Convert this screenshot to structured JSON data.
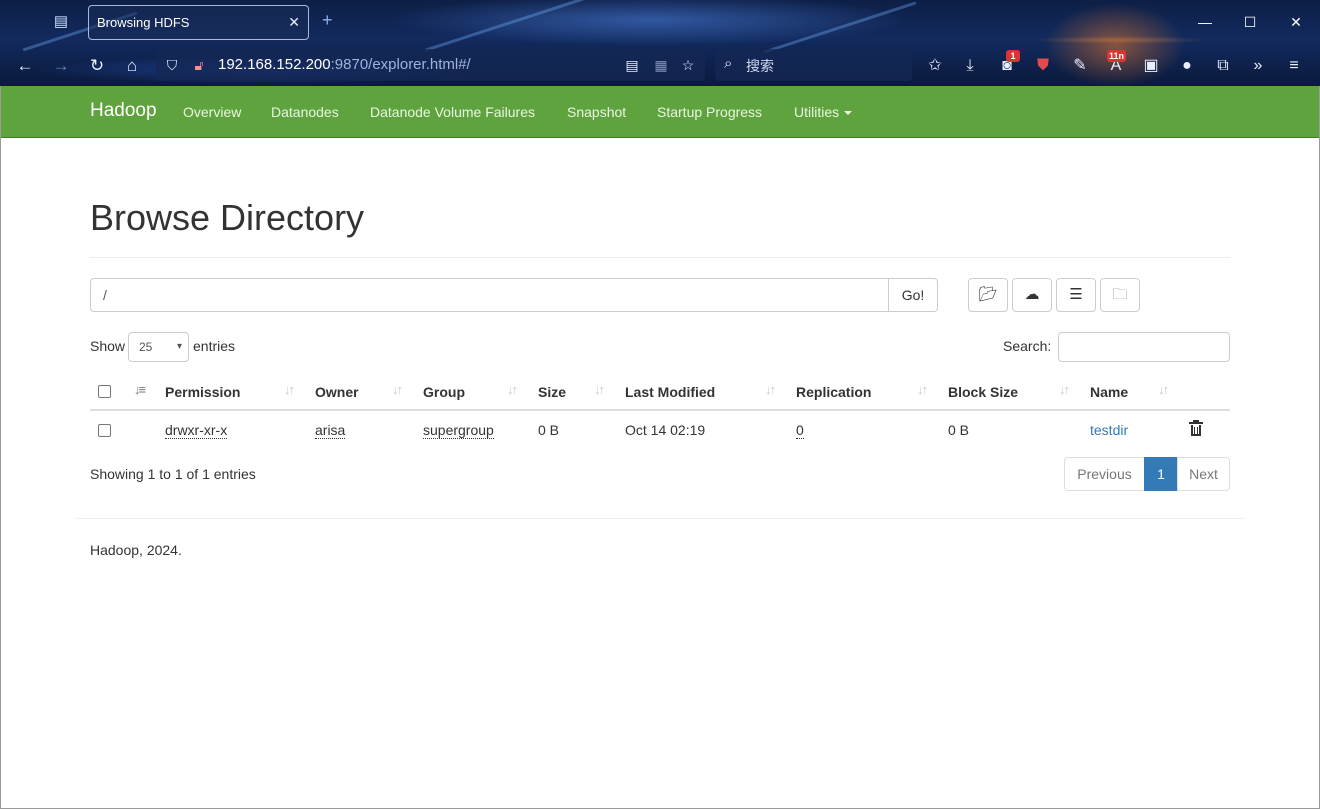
{
  "browser": {
    "tab_title": "Browsing HDFS",
    "tab_close": "✕",
    "new_tab": "+",
    "url_host": "192.168.152.200",
    "url_rest": ":9870/explorer.html#/",
    "search_placeholder": "搜索",
    "badges": {
      "tool3": "1",
      "tool6": "11n"
    },
    "window_buttons": {
      "minimize": "—",
      "maximize": "☐",
      "close": "✕"
    }
  },
  "navbar": {
    "brand": "Hadoop",
    "links": [
      "Overview",
      "Datanodes",
      "Datanode Volume Failures",
      "Snapshot",
      "Startup Progress",
      "Utilities"
    ]
  },
  "page": {
    "title": "Browse Directory",
    "path_value": "/",
    "go_label": "Go!",
    "show_label": "Show",
    "page_length": "25",
    "entries_label": "entries",
    "search_label": "Search:"
  },
  "table": {
    "headers": [
      "Permission",
      "Owner",
      "Group",
      "Size",
      "Last Modified",
      "Replication",
      "Block Size",
      "Name"
    ],
    "rows": [
      {
        "permission": "drwxr-xr-x",
        "owner": "arisa",
        "group": "supergroup",
        "size": "0 B",
        "last_modified": "Oct 14 02:19",
        "replication": "0",
        "block_size": "0 B",
        "name": "testdir"
      }
    ]
  },
  "pagination": {
    "info": "Showing 1 to 1 of 1 entries",
    "previous": "Previous",
    "current": "1",
    "next": "Next"
  },
  "footer": {
    "text": "Hadoop, 2024."
  },
  "colors": {
    "navbar_bg": "#5fa33e",
    "link": "#337ab7",
    "pager_active": "#337ab7"
  }
}
